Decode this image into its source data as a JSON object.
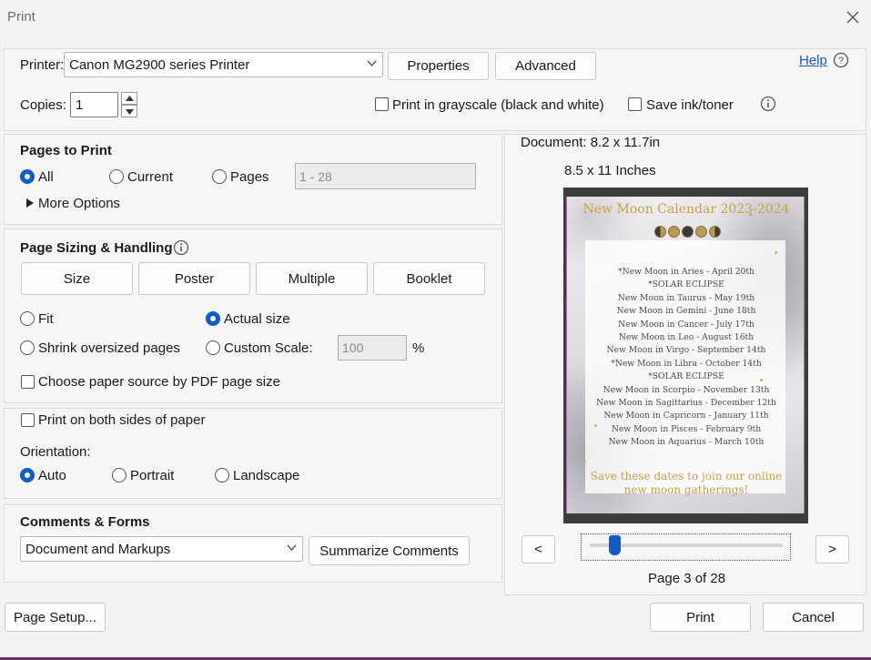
{
  "window": {
    "title": "Print"
  },
  "header": {
    "printer_label": "Printer:",
    "printer_value": "Canon MG2900 series Printer",
    "properties_label": "Properties",
    "advanced_label": "Advanced",
    "help_label": "Help",
    "copies_label": "Copies:",
    "copies_value": "1",
    "grayscale_label": "Print in grayscale (black and white)",
    "save_ink_label": "Save ink/toner"
  },
  "pages_to_print": {
    "heading": "Pages to Print",
    "all_label": "All",
    "current_label": "Current",
    "pages_label": "Pages",
    "pages_range": "1 - 28",
    "more_options": "More Options",
    "selected": "All"
  },
  "sizing": {
    "heading": "Page Sizing & Handling",
    "tabs": [
      "Size",
      "Poster",
      "Multiple",
      "Booklet"
    ],
    "fit_label": "Fit",
    "actual_size_label": "Actual size",
    "shrink_label": "Shrink oversized pages",
    "custom_scale_label": "Custom Scale:",
    "custom_scale_value": "100",
    "percent_sign": "%",
    "paper_source_label": "Choose paper source by PDF page size",
    "selected": "Actual size"
  },
  "duplex": {
    "both_sides_label": "Print on both sides of paper",
    "orientation_label": "Orientation:",
    "auto_label": "Auto",
    "portrait_label": "Portrait",
    "landscape_label": "Landscape",
    "selected": "Auto"
  },
  "comments": {
    "heading": "Comments & Forms",
    "select_value": "Document and Markups",
    "summarize_label": "Summarize Comments"
  },
  "preview": {
    "document_size": "Document: 8.2 x 11.7in",
    "paper_size": "8.5 x 11 Inches",
    "page_title": "New Moon Calendar 2023-2024",
    "lines": [
      "*New Moon in Aries - April 20th",
      "*SOLAR ECLIPSE",
      "New  Moon in Taurus - May 19th",
      "New Moon in Gemini - June 18th",
      "New Moon in Cancer  - July 17th",
      "New Moon in Leo - August 16th",
      "New Moon in Virgo - September 14th",
      "*New Moon in Libra - October 14th",
      "*SOLAR ECLIPSE",
      "New Moon in Scorpio - November 13th",
      "New Moon in Sagittarius - December 12th",
      "New Moon in Capricorn - January 11th",
      "New Moon in Pisces - February 9th",
      "New Moon in Aquarius - March 10th"
    ],
    "footer_line1": "Save these dates to join our online",
    "footer_line2": "new moon gatherings!",
    "prev_label": "<",
    "next_label": ">",
    "page_indicator": "Page 3 of 28",
    "slider_position": 0.107
  },
  "footer": {
    "page_setup_label": "Page Setup...",
    "print_label": "Print",
    "cancel_label": "Cancel"
  },
  "colors": {
    "accent": "#0d5cc9",
    "link": "#1a56c9",
    "gold": "#c9a24a"
  }
}
